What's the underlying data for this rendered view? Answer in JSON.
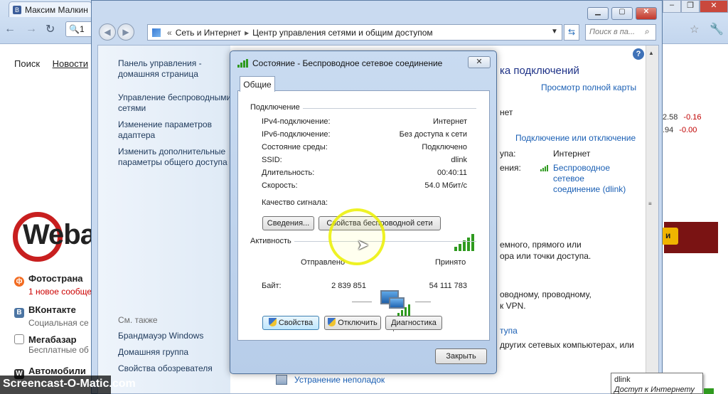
{
  "browser": {
    "tab_title": "Максим Малкин",
    "address_fragment": "1",
    "page_links": [
      "Поиск",
      "Новости"
    ],
    "logo_text": "Weba",
    "services": [
      {
        "title": "Фотострана",
        "subtitle": "1 новое сообще",
        "icon": "fotostrana-icon",
        "color": "#f26b21"
      },
      {
        "title": "ВКонтакте",
        "subtitle": "Социальная се",
        "icon": "vkontakte-icon",
        "color": "#4c75a3"
      },
      {
        "title": "Мегабазар",
        "subtitle": "Бесплатные об",
        "icon": "checkbox-icon",
        "color": "#ffffff"
      },
      {
        "title": "Автомобили",
        "subtitle": "",
        "icon": "wikimart-icon",
        "color": "#333333"
      }
    ],
    "quotes": [
      {
        "value": "2.58",
        "change": "-0.16"
      },
      {
        "value": ".94",
        "change": "-0.00"
      }
    ]
  },
  "control_panel": {
    "breadcrumb": [
      "Сеть и Интернет",
      "Центр управления сетями и общим доступом"
    ],
    "search_placeholder": "Поиск в па...",
    "left_links": [
      "Панель управления - домашняя страница",
      "Управление беспроводными сетями",
      "Изменение параметров адаптера",
      "Изменить дополнительные параметры общего доступа"
    ],
    "see_also_label": "См. также",
    "see_also": [
      "Брандмауэр Windows",
      "Домашняя группа",
      "Свойства обозревателя"
    ],
    "main_title_fragment": "ка подключений",
    "full_map_link": "Просмотр полной карты",
    "text_fragments": {
      "internet_frag": "нет",
      "connect_disconnect": "Подключение или отключение",
      "access_type_frag": "упа:",
      "access_type_value": "Интернет",
      "connections_frag": "ения:",
      "connection_name": "Беспроводное сетевое соединение (dlink)",
      "setup_frag_1": "емного, прямого или",
      "setup_frag_2": "ора или точки доступа.",
      "setup_frag_3": "оводному, проводному,",
      "setup_frag_4": "к VPN.",
      "homegroup_frag": "тупа",
      "other_frag": "других сетевых компьютерах, или",
      "troubleshoot": "Устранение неполадок"
    }
  },
  "dialog": {
    "title": "Состояние - Беспроводное сетевое соединение",
    "tab": "Общие",
    "connection_label": "Подключение",
    "rows": [
      {
        "label": "IPv4-подключение:",
        "value": "Интернет"
      },
      {
        "label": "IPv6-подключение:",
        "value": "Без доступа к сети"
      },
      {
        "label": "Состояние среды:",
        "value": "Подключено"
      },
      {
        "label": "SSID:",
        "value": "dlink"
      },
      {
        "label": "Длительность:",
        "value": "00:40:11"
      },
      {
        "label": "Скорость:",
        "value": "54.0 Мбит/с"
      }
    ],
    "signal_label": "Качество сигнала:",
    "signal_bars": 5,
    "details_button": "Сведения...",
    "wireless_props_button": "Свойства беспроводной сети",
    "activity_label": "Активность",
    "sent_label": "Отправлено",
    "received_label": "Принято",
    "bytes_label": "Байт:",
    "bytes_sent": "2 839 851",
    "bytes_received": "54 111 783",
    "properties_button": "Свойства",
    "disable_button": "Отключить",
    "diagnose_button": "Диагностика",
    "close_button": "Закрыть"
  },
  "tooltip": {
    "title": "dlink",
    "subtitle": "Доступ к Интернету"
  },
  "watermark": "Screencast-O-Matic.com"
}
